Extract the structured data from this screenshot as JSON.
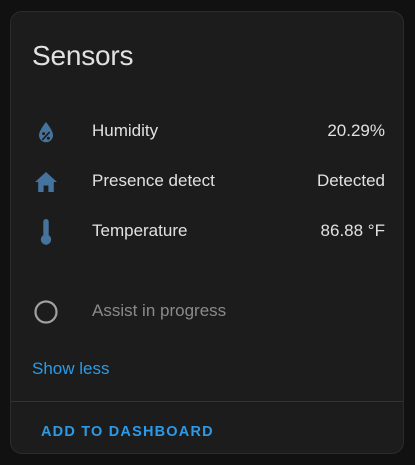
{
  "card": {
    "title": "Sensors",
    "entities": [
      {
        "icon": "water-percent-icon",
        "name": "Humidity",
        "value": "20.29%"
      },
      {
        "icon": "home-icon",
        "name": "Presence detect",
        "value": "Detected"
      },
      {
        "icon": "thermometer-icon",
        "name": "Temperature",
        "value": "86.88 °F"
      }
    ],
    "extra": {
      "icon": "circle-outline-icon",
      "name": "Assist in progress"
    },
    "show_less": "Show less",
    "add_to_dashboard": "ADD TO DASHBOARD"
  },
  "colors": {
    "icon": "#44739e",
    "accent": "#2c9ae8",
    "text": "#e1e1e1",
    "secondary_text": "#8a8a8a",
    "card_background": "#1c1c1c"
  }
}
